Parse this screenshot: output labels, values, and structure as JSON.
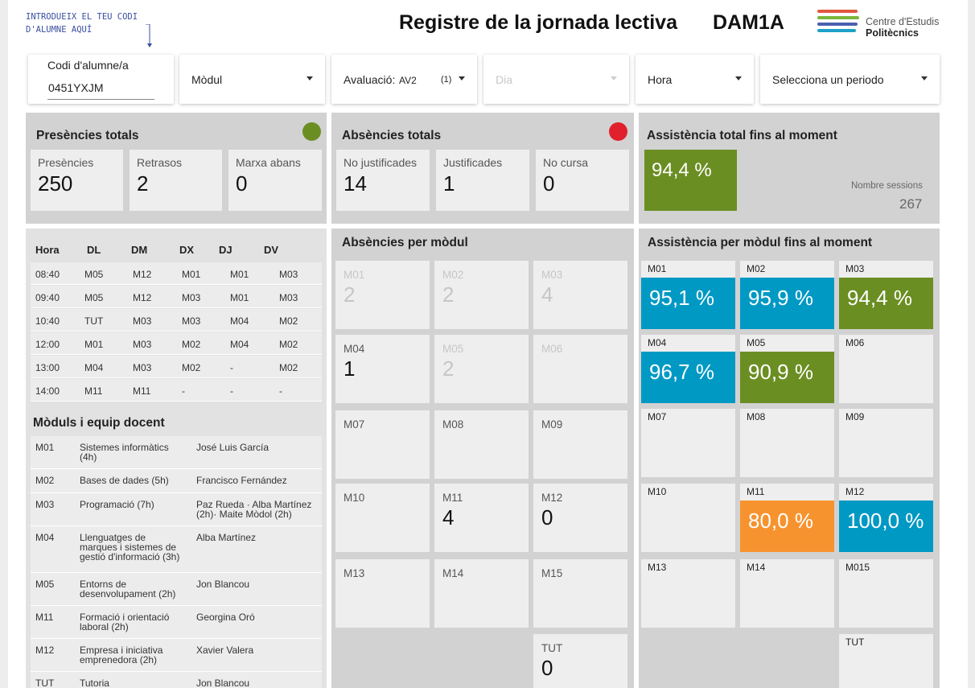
{
  "header": {
    "hint": "INTRODUEIX EL TEU CODI D'ALUMNE AQUÍ",
    "title": "Registre de la jornada lectiva",
    "group": "DAM1A",
    "logo_line1": "Centre d'Estudis",
    "logo_line2": "Politècnics",
    "logo_colors": [
      "#e0573f",
      "#7ab63a",
      "#4a5fb0",
      "#1ea0c8"
    ]
  },
  "controls": {
    "codi_label": "Codi d'alumne/a",
    "codi_value": "0451YXJM",
    "modul": "Mòdul",
    "avaluacio_label": "Avaluació:",
    "avaluacio_value": "AV2",
    "avaluacio_count": "(1)",
    "dia": "Dia",
    "hora": "Hora",
    "periode": "Selecciona un periodo"
  },
  "presencies": {
    "title": "Presències totals",
    "status_color": "#6b8e23",
    "cards": [
      {
        "label": "Presències",
        "value": "250"
      },
      {
        "label": "Retrasos",
        "value": "2"
      },
      {
        "label": "Marxa abans",
        "value": "0"
      }
    ]
  },
  "absencies": {
    "title": "Absències totals",
    "status_color": "#e0202a",
    "cards": [
      {
        "label": "No justificades",
        "value": "14"
      },
      {
        "label": "Justificades",
        "value": "1"
      },
      {
        "label": "No cursa",
        "value": "0"
      }
    ]
  },
  "assistencia": {
    "title": "Assistència total fins al moment",
    "value": "94,4 %",
    "sessions_label": "Nombre sessions",
    "sessions_value": "267"
  },
  "schedule": {
    "headers": [
      "Hora",
      "DL",
      "DM",
      "DX",
      "DJ",
      "DV"
    ],
    "rows": [
      [
        "08:40",
        "M05",
        "M12",
        "M01",
        "M01",
        "M03"
      ],
      [
        "09:40",
        "M05",
        "M12",
        "M03",
        "M01",
        "M03"
      ],
      [
        "10:40",
        "TUT",
        "M03",
        "M03",
        "M04",
        "M02"
      ],
      [
        "12:00",
        "M01",
        "M03",
        "M02",
        "M04",
        "M02"
      ],
      [
        "13:00",
        "M04",
        "M03",
        "M02",
        "-",
        "M02"
      ],
      [
        "14:00",
        "M11",
        "M11",
        "-",
        "-",
        "-"
      ]
    ]
  },
  "team": {
    "title": "Mòduls i equip docent",
    "rows": [
      {
        "code": "M01",
        "name": "Sistemes informàtics (4h)",
        "teacher": "José Luis García"
      },
      {
        "code": "M02",
        "name": "Bases de dades (5h)",
        "teacher": "Francisco Fernández"
      },
      {
        "code": "M03",
        "name": "Programació (7h)",
        "teacher": "Paz Rueda · Alba Martínez (2h)· Maite Mòdol (2h)"
      },
      {
        "code": "M04",
        "name": "Llenguatges de marques i sistemes de gestió d'informació (3h)",
        "teacher": "Alba Martínez"
      },
      {
        "code": "M05",
        "name": "Entorns de desenvolupament (2h)",
        "teacher": "Jon Blancou"
      },
      {
        "code": "M11",
        "name": "Formació i orientació laboral (2h)",
        "teacher": "Georgina Oró"
      },
      {
        "code": "M12",
        "name": "Empresa i iniciativa emprenedora (2h)",
        "teacher": "Xavier Valera"
      },
      {
        "code": "TUT",
        "name": "Tutoria",
        "teacher": "Jon Blancou"
      }
    ]
  },
  "absencies_modul": {
    "title": "Absències per mòdul",
    "cells": [
      {
        "label": "M01",
        "value": "2",
        "dim": true
      },
      {
        "label": "M02",
        "value": "2",
        "dim": true
      },
      {
        "label": "M03",
        "value": "4",
        "dim": true
      },
      {
        "label": "M04",
        "value": "1",
        "dim": false
      },
      {
        "label": "M05",
        "value": "2",
        "dim": true
      },
      {
        "label": "M06",
        "value": "",
        "dim": true
      },
      {
        "label": "M07",
        "value": "",
        "dim": false
      },
      {
        "label": "M08",
        "value": "",
        "dim": false
      },
      {
        "label": "M09",
        "value": "",
        "dim": false
      },
      {
        "label": "M10",
        "value": "",
        "dim": false
      },
      {
        "label": "M11",
        "value": "4",
        "dim": false
      },
      {
        "label": "M12",
        "value": "0",
        "dim": false
      },
      {
        "label": "M13",
        "value": "",
        "dim": false
      },
      {
        "label": "M14",
        "value": "",
        "dim": false
      },
      {
        "label": "M15",
        "value": "",
        "dim": false
      },
      {
        "label": "TUT",
        "value": "0",
        "dim": false
      }
    ]
  },
  "assistencia_modul": {
    "title": "Assistència per mòdul fins al moment",
    "cells": [
      {
        "label": "M01",
        "value": "95,1 %",
        "color": "#0099c4"
      },
      {
        "label": "M02",
        "value": "95,9 %",
        "color": "#0099c4"
      },
      {
        "label": "M03",
        "value": "94,4 %",
        "color": "#6b8e23"
      },
      {
        "label": "M04",
        "value": "96,7 %",
        "color": "#0099c4"
      },
      {
        "label": "M05",
        "value": "90,9 %",
        "color": "#6b8e23"
      },
      {
        "label": "M06",
        "value": "",
        "color": ""
      },
      {
        "label": "M07",
        "value": "",
        "color": ""
      },
      {
        "label": "M08",
        "value": "",
        "color": ""
      },
      {
        "label": "M09",
        "value": "",
        "color": ""
      },
      {
        "label": "M10",
        "value": "",
        "color": ""
      },
      {
        "label": "M11",
        "value": "80,0 %",
        "color": "#f7932f"
      },
      {
        "label": "M12",
        "value": "100,0 %",
        "color": "#0099c4"
      },
      {
        "label": "M13",
        "value": "",
        "color": ""
      },
      {
        "label": "M14",
        "value": "",
        "color": ""
      },
      {
        "label": "M015",
        "value": "",
        "color": ""
      },
      {
        "label": "TUT",
        "value": "",
        "color": ""
      }
    ]
  }
}
